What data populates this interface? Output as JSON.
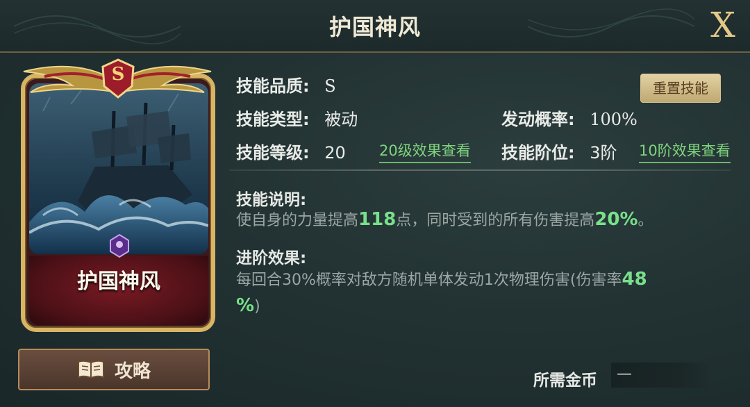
{
  "window": {
    "title": "护国神风",
    "close_label": "X"
  },
  "card": {
    "grade_letter": "S",
    "name": "护国神风"
  },
  "guide_button": {
    "label": "攻略",
    "icon": "book-icon"
  },
  "reset_button": {
    "label": "重置技能"
  },
  "attributes": {
    "quality": {
      "label": "技能品质:",
      "value": "S"
    },
    "type": {
      "label": "技能类型:",
      "value": "被动"
    },
    "trigger_rate": {
      "label": "发动概率:",
      "value": "100%"
    },
    "level": {
      "label": "技能等级:",
      "value": "20"
    },
    "level_link": "20级效果查看",
    "rank": {
      "label": "技能阶位:",
      "value": "3阶"
    },
    "rank_link": "10阶效果查看"
  },
  "description": {
    "title": "技能说明:",
    "text_before": "使自身的力量提高",
    "value1": "118",
    "text_mid": "点，同时受到的所有伤害提高",
    "value2": "20%",
    "text_after": "。"
  },
  "advance": {
    "title": "进阶效果:",
    "text_before": "每回合30%概率对敌方随机单体发动1次物理伤害(伤害率",
    "value1": "48",
    "value2": "%",
    "text_after": ")"
  },
  "cost": {
    "label": "所需金币",
    "value": "—"
  },
  "colors": {
    "highlight": "#78e08a",
    "gold_frame": "#d8b464",
    "card_red": "#7a1a24",
    "background": "#223233"
  }
}
